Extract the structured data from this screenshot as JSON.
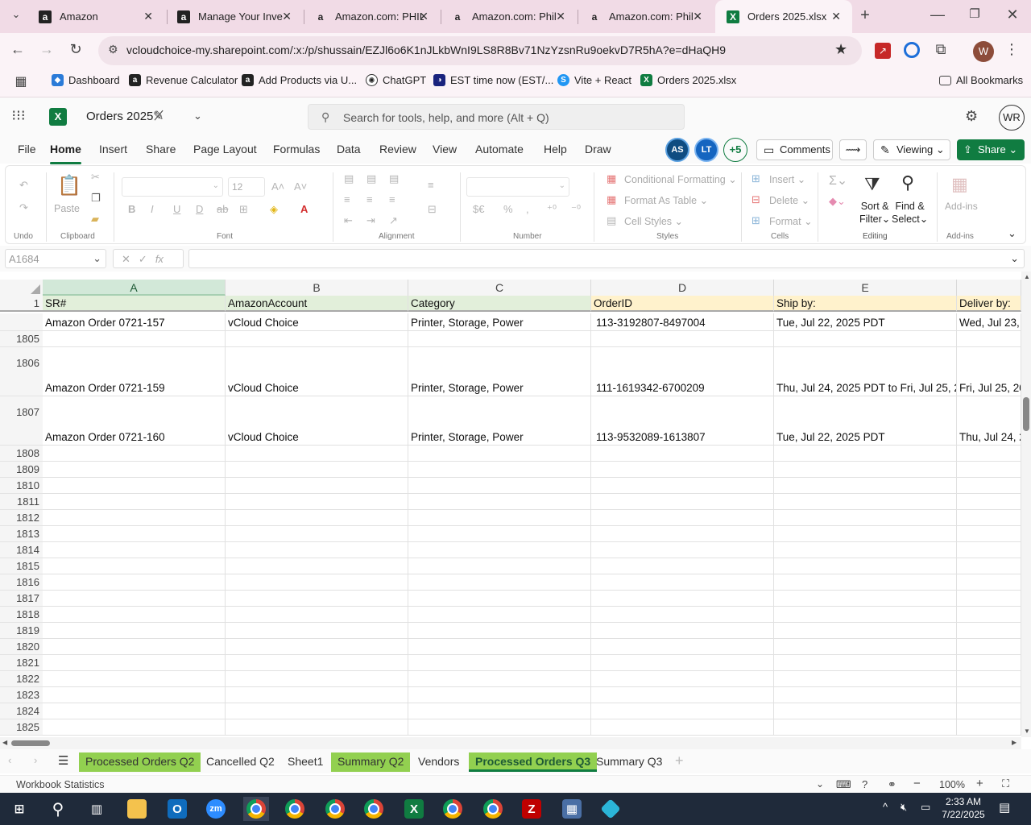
{
  "browser": {
    "tabs": [
      {
        "title": "Amazon",
        "icon": "amazon-icon"
      },
      {
        "title": "Manage Your Inve",
        "icon": "amazon-icon"
      },
      {
        "title": "Amazon.com: PHIL",
        "icon": "amazon-icon"
      },
      {
        "title": "Amazon.com: Phil",
        "icon": "amazon-icon"
      },
      {
        "title": "Amazon.com: Phil",
        "icon": "amazon-icon"
      },
      {
        "title": "Orders 2025.xlsx",
        "icon": "excel-icon"
      }
    ],
    "url": "vcloudchoice-my.sharepoint.com/:x:/p/shussain/EZJl6o6K1nJLkbWnI9LS8R8Bv71NzYzsnRu9oekvD7R5hA?e=dHaQH9",
    "profile_initial": "W",
    "bookmarks": [
      "Dashboard",
      "Revenue Calculator",
      "Add Products via U...",
      "ChatGPT",
      "EST time now (EST/...",
      "Vite + React",
      "Orders 2025.xlsx"
    ],
    "all_bookmarks": "All Bookmarks"
  },
  "excel": {
    "doc_title": "Orders 2025",
    "search_placeholder": "Search for tools, help, and more (Alt + Q)",
    "user_initials": "WR",
    "menu": [
      "File",
      "Home",
      "Insert",
      "Share",
      "Page Layout",
      "Formulas",
      "Data",
      "Review",
      "View",
      "Automate",
      "Help",
      "Draw"
    ],
    "active_menu": "Home",
    "collaborators": [
      "AS",
      "LT"
    ],
    "more_collaborators": "+5",
    "comments_label": "Comments",
    "viewing_label": "Viewing",
    "share_label": "Share",
    "ribbon": {
      "undo_group": "Undo",
      "paste": "Paste",
      "clipboard_group": "Clipboard",
      "font_size": "12",
      "font_group": "Font",
      "alignment_group": "Alignment",
      "number_group": "Number",
      "conditional_formatting": "Conditional Formatting",
      "format_as_table": "Format As Table",
      "cell_styles": "Cell Styles",
      "styles_group": "Styles",
      "insert": "Insert",
      "delete": "Delete",
      "format": "Format",
      "cells_group": "Cells",
      "sort_filter_1": "Sort &",
      "sort_filter_2": "Filter",
      "find_select_1": "Find &",
      "find_select_2": "Select",
      "editing_group": "Editing",
      "addins_label": "Add-ins",
      "addins_group": "Add-ins"
    },
    "name_box": "A1684",
    "columns": [
      "A",
      "B",
      "C",
      "D",
      "E"
    ],
    "header_row_num": "1",
    "headers": [
      "SR#",
      "AmazonAccount",
      "Category",
      "OrderID",
      "Ship by:",
      "Deliver by:"
    ],
    "rows": [
      {
        "num": "",
        "cells": [
          "Amazon Order 0721-157",
          "vCloud Choice",
          "Printer, Storage, Power",
          "113-3192807-8497004",
          "Tue, Jul 22, 2025 PDT",
          "Wed, Jul 23, 2"
        ]
      },
      {
        "num": "1805",
        "cells": [
          "",
          "",
          "",
          "",
          "",
          ""
        ]
      },
      {
        "num": "1806",
        "cells": [
          "Amazon Order 0721-159",
          "vCloud Choice",
          "Printer, Storage, Power",
          "111-1619342-6700209",
          "Thu, Jul 24, 2025 PDT to Fri, Jul 25, 20",
          "Fri, Jul 25, 20"
        ]
      },
      {
        "num": "1807",
        "cells": [
          "Amazon Order 0721-160",
          "vCloud Choice",
          "Printer, Storage, Power",
          "113-9532089-1613807",
          "Tue, Jul 22, 2025 PDT",
          "Thu, Jul 24, 2"
        ]
      }
    ],
    "empty_rows": [
      "1808",
      "1809",
      "1810",
      "1811",
      "1812",
      "1813",
      "1814",
      "1815",
      "1816",
      "1817",
      "1818",
      "1819",
      "1820",
      "1821",
      "1822",
      "1823",
      "1824",
      "1825"
    ],
    "sheets": [
      {
        "name": "Processed Orders Q2",
        "highlight": true,
        "active": false
      },
      {
        "name": "Cancelled Q2",
        "highlight": false,
        "active": false
      },
      {
        "name": "Sheet1",
        "highlight": false,
        "active": false
      },
      {
        "name": "Summary Q2",
        "highlight": true,
        "active": false
      },
      {
        "name": "Vendors",
        "highlight": false,
        "active": false
      },
      {
        "name": "Processed Orders Q3",
        "highlight": true,
        "active": true
      },
      {
        "name": "Summary Q3",
        "highlight": false,
        "active": false
      }
    ],
    "status_left": "Workbook Statistics",
    "zoom": "100%"
  },
  "taskbar": {
    "time": "2:33 AM",
    "date": "7/22/2025"
  },
  "colors": {
    "excel_green": "#107c41",
    "sheet_highlight": "#92d050",
    "header_fill_yellow": "#fff2cc",
    "header_fill_green": "#e2efda"
  }
}
